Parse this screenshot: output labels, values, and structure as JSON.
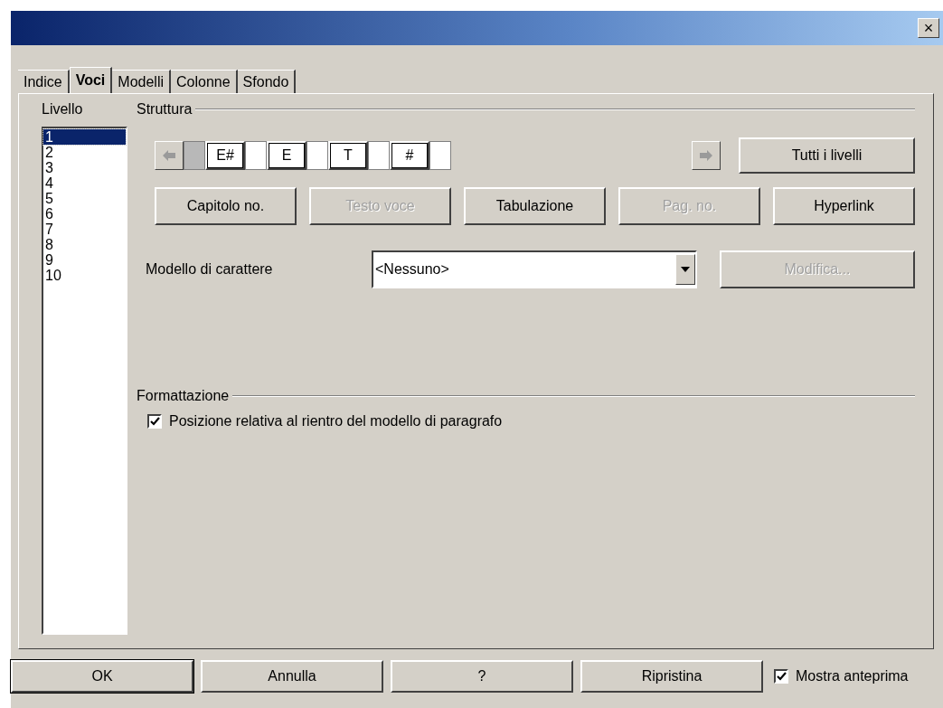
{
  "window": {
    "close": "×"
  },
  "tabs": [
    {
      "label": "Indice",
      "selected": false
    },
    {
      "label": "Voci",
      "selected": true
    },
    {
      "label": "Modelli",
      "selected": false
    },
    {
      "label": "Colonne",
      "selected": false
    },
    {
      "label": "Sfondo",
      "selected": false
    }
  ],
  "levels": {
    "title": "Livello",
    "items": [
      {
        "label": "1",
        "selected": true
      },
      {
        "label": "2",
        "selected": false
      },
      {
        "label": "3",
        "selected": false
      },
      {
        "label": "4",
        "selected": false
      },
      {
        "label": "5",
        "selected": false
      },
      {
        "label": "6",
        "selected": false
      },
      {
        "label": "7",
        "selected": false
      },
      {
        "label": "8",
        "selected": false
      },
      {
        "label": "9",
        "selected": false
      },
      {
        "label": "10",
        "selected": false
      }
    ]
  },
  "structure": {
    "title": "Struttura",
    "tokens": [
      {
        "kind": "gap",
        "selected": true
      },
      {
        "kind": "token",
        "label": "E#"
      },
      {
        "kind": "gap",
        "selected": false
      },
      {
        "kind": "token",
        "label": "E"
      },
      {
        "kind": "gap",
        "selected": false
      },
      {
        "kind": "token",
        "label": "T"
      },
      {
        "kind": "gap",
        "selected": false
      },
      {
        "kind": "token",
        "label": "#"
      },
      {
        "kind": "gap",
        "selected": false
      }
    ],
    "all_levels": {
      "label": "Tutti i livelli"
    },
    "buttons": [
      {
        "label": "Capitolo no.",
        "disabled": false
      },
      {
        "label": "Testo voce",
        "disabled": true
      },
      {
        "label": "Tabulazione",
        "disabled": false
      },
      {
        "label": "Pag. no.",
        "disabled": true
      },
      {
        "label": "Hyperlink",
        "disabled": false
      }
    ],
    "char_style": {
      "label": "Modello di carattere",
      "value": "<Nessuno>",
      "edit": {
        "label": "Modifica...",
        "disabled": true
      }
    }
  },
  "formatting": {
    "title": "Formattazione",
    "option": {
      "label": "Posizione relativa al rientro del modello di paragrafo",
      "checked": true
    }
  },
  "footer": {
    "buttons": [
      {
        "label": "OK",
        "default": true
      },
      {
        "label": "Annulla",
        "default": false
      },
      {
        "label": "?",
        "default": false
      },
      {
        "label": "Ripristina",
        "default": false
      }
    ],
    "preview": {
      "label": "Mostra anteprima",
      "checked": true
    }
  }
}
